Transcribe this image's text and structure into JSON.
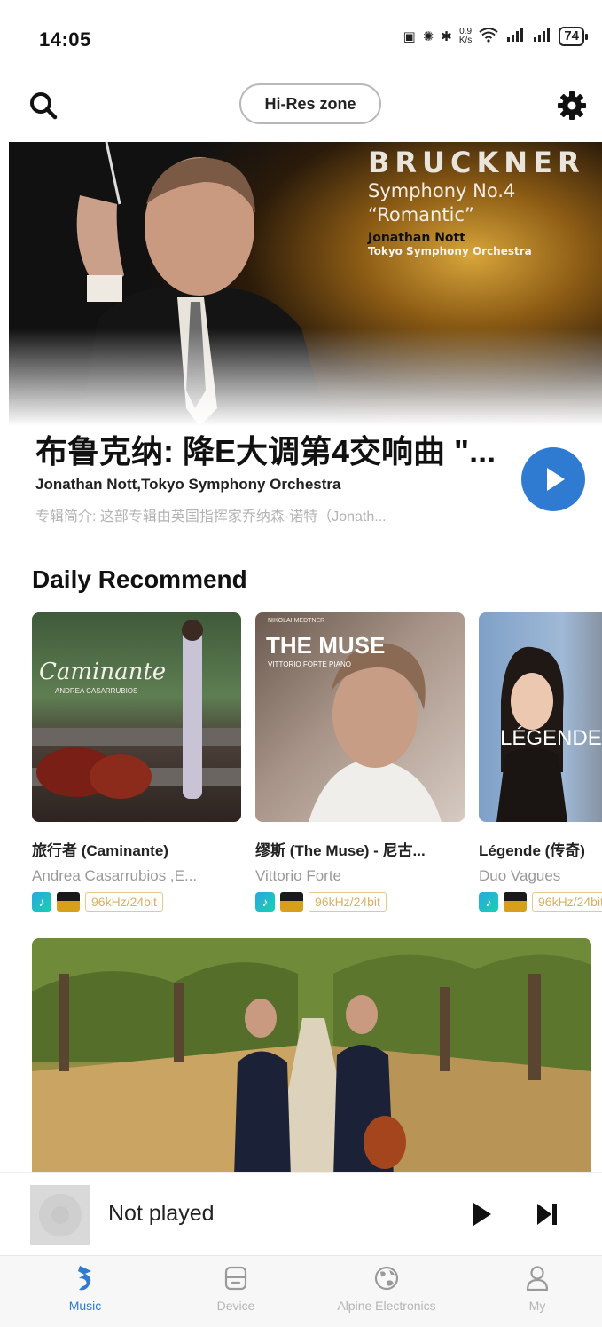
{
  "status_bar": {
    "time": "14:05",
    "speed_top": "0.9",
    "speed_unit": "K/s",
    "battery": "74"
  },
  "header": {
    "hires_label": "Hi-Res zone"
  },
  "hero": {
    "composer": "BRUCKNER",
    "work": "Symphony No.4",
    "nickname": "“Romantic”",
    "conductor": "Jonathan Nott",
    "orchestra": "Tokyo Symphony Orchestra"
  },
  "featured": {
    "title": "布鲁克纳: 降E大调第4交响曲 \"...",
    "artist": "Jonathan Nott,Tokyo Symphony Orchestra",
    "description": "专辑简介:  这部专辑由英国指挥家乔纳森·诺特（Jonath..."
  },
  "daily": {
    "section_title": "Daily Recommend",
    "albums": [
      {
        "title": "旅行者 (Caminante)",
        "artist": "Andrea Casarrubios ,E...",
        "rate": "96kHz/24bit",
        "cover_text": "Caminante",
        "cover_subtext": "ANDREA CASARRUBIOS"
      },
      {
        "title": "缪斯 (The Muse) - 尼古...",
        "artist": "Vittorio Forte",
        "rate": "96kHz/24bit",
        "cover_text": "THE MUSE",
        "cover_subtext": "VITTORIO FORTE PIANO",
        "cover_toptext": "NIKOLAI MEDTNER"
      },
      {
        "title": "Légende (传奇)",
        "artist": "Duo Vagues",
        "rate": "96kHz/24bit",
        "cover_text": "LÉGENDE"
      }
    ]
  },
  "mini_player": {
    "status": "Not played"
  },
  "tabs": [
    {
      "label": "Music",
      "icon": "music-note-icon",
      "active": true
    },
    {
      "label": "Device",
      "icon": "device-icon",
      "active": false
    },
    {
      "label": "Alpine Electronics",
      "icon": "globe-icon",
      "active": false
    },
    {
      "label": "My",
      "icon": "person-icon",
      "active": false
    }
  ],
  "colors": {
    "accent": "#2f7bd2",
    "rate_badge": "#d8b060"
  }
}
